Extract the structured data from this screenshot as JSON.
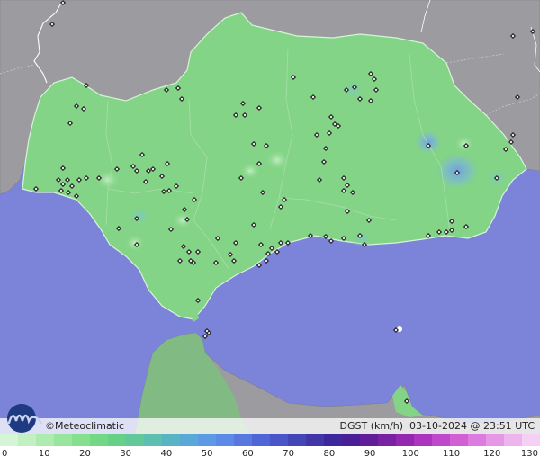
{
  "credit": "©Meteoclimatic",
  "info": {
    "variable": "DGST",
    "unit": "(km/h)",
    "date": "03-10-2024",
    "at": "@",
    "time": "23:51",
    "tz": "UTC"
  },
  "legend": {
    "labels": [
      "0",
      "10",
      "20",
      "30",
      "40",
      "50",
      "60",
      "70",
      "80",
      "90",
      "100",
      "110",
      "120",
      "130"
    ],
    "colors": [
      "#d6f5d6",
      "#c2f0c2",
      "#aeebb0",
      "#98e59e",
      "#84df8e",
      "#72d886",
      "#66d086",
      "#62c89a",
      "#5cbfb0",
      "#58b4c4",
      "#5aa8d8",
      "#5c9ae4",
      "#5c8ae6",
      "#5878e0",
      "#5066d6",
      "#4a56c8",
      "#4446b8",
      "#4036a8",
      "#3c289c",
      "#4a1e96",
      "#601e9a",
      "#7a22a4",
      "#9428b0",
      "#ac34be",
      "#c048ca",
      "#d060d4",
      "#dc7cde",
      "#e698e6",
      "#eeb4ee",
      "#f4d0f4"
    ]
  },
  "colors": {
    "sea": "#7b84d9",
    "land": "#83d486",
    "foreign": "#9a9a9e",
    "station": "#1a1a1a"
  }
}
